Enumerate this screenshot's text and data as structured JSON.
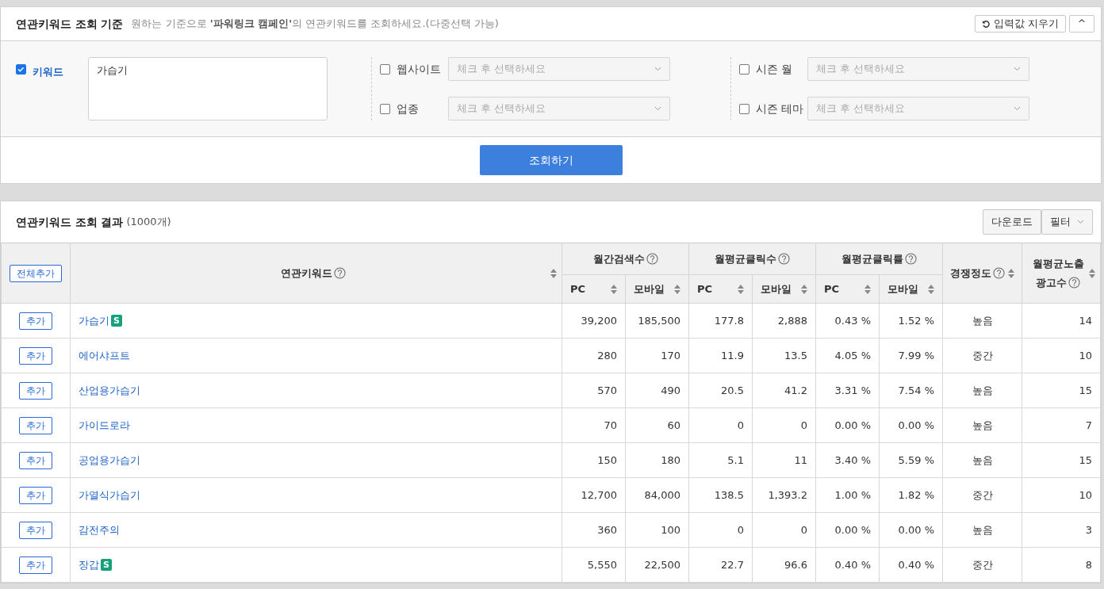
{
  "criteria": {
    "title": "연관키워드 조회 기준",
    "description": "원하는 기준으로 **'파워링크 캠페인'**의 연관키워드를 조회하세요.(다중선택 가능)",
    "reset_button": "입력값 지우기",
    "collapse_button": "^",
    "keyword": {
      "label": "키워드",
      "checked": true,
      "value": "가습기"
    },
    "filter_columns": [
      [
        {
          "label": "웹사이트",
          "checked": false,
          "placeholder": "체크 후 선택하세요"
        },
        {
          "label": "업종",
          "checked": false,
          "placeholder": "체크 후 선택하세요"
        }
      ],
      [
        {
          "label": "시즌 월",
          "checked": false,
          "placeholder": "체크 후 선택하세요"
        },
        {
          "label": "시즌 테마",
          "checked": false,
          "placeholder": "체크 후 선택하세요"
        }
      ]
    ],
    "search_button": "조회하기"
  },
  "results": {
    "title": "연관키워드 조회 결과",
    "count": "(1000개)",
    "download_button": "다운로드",
    "filter_button": "필터",
    "add_all_button": "전체추가",
    "keyword_column": "연관키워드",
    "column_groups": [
      {
        "label": "월간검색수",
        "columns": [
          "PC",
          "모바일"
        ]
      },
      {
        "label": "월평균클릭수",
        "columns": [
          "PC",
          "모바일"
        ]
      },
      {
        "label": "월평균클릭률",
        "columns": [
          "PC",
          "모바일"
        ]
      }
    ],
    "competition_column": "경쟁정도",
    "ads_column": [
      "월평균노출",
      "광고수"
    ],
    "rows": [
      {
        "add": "추가",
        "keyword": "가습기",
        "badge": "S",
        "values": [
          "39,200",
          "185,500",
          "177.8",
          "2,888",
          "0.43 %",
          "1.52 %"
        ],
        "competition": "높음",
        "ads": "14"
      },
      {
        "add": "추가",
        "keyword": "에어샤프트",
        "values": [
          "280",
          "170",
          "11.9",
          "13.5",
          "4.05 %",
          "7.99 %"
        ],
        "competition": "중간",
        "ads": "10"
      },
      {
        "add": "추가",
        "keyword": "산업용가습기",
        "values": [
          "570",
          "490",
          "20.5",
          "41.2",
          "3.31 %",
          "7.54 %"
        ],
        "competition": "높음",
        "ads": "15"
      },
      {
        "add": "추가",
        "keyword": "가이드로라",
        "values": [
          "70",
          "60",
          "0",
          "0",
          "0.00 %",
          "0.00 %"
        ],
        "competition": "높음",
        "ads": "7"
      },
      {
        "add": "추가",
        "keyword": "공업용가습기",
        "values": [
          "150",
          "180",
          "5.1",
          "11",
          "3.40 %",
          "5.59 %"
        ],
        "competition": "높음",
        "ads": "15"
      },
      {
        "add": "추가",
        "keyword": "가열식가습기",
        "values": [
          "12,700",
          "84,000",
          "138.5",
          "1,393.2",
          "1.00 %",
          "1.82 %"
        ],
        "competition": "중간",
        "ads": "10"
      },
      {
        "add": "추가",
        "keyword": "감전주의",
        "values": [
          "360",
          "100",
          "0",
          "0",
          "0.00 %",
          "0.00 %"
        ],
        "competition": "높음",
        "ads": "3"
      },
      {
        "add": "추가",
        "keyword": "장갑",
        "badge": "S",
        "values": [
          "5,550",
          "22,500",
          "22.7",
          "96.6",
          "0.40 %",
          "0.40 %"
        ],
        "competition": "중간",
        "ads": "8"
      }
    ]
  }
}
